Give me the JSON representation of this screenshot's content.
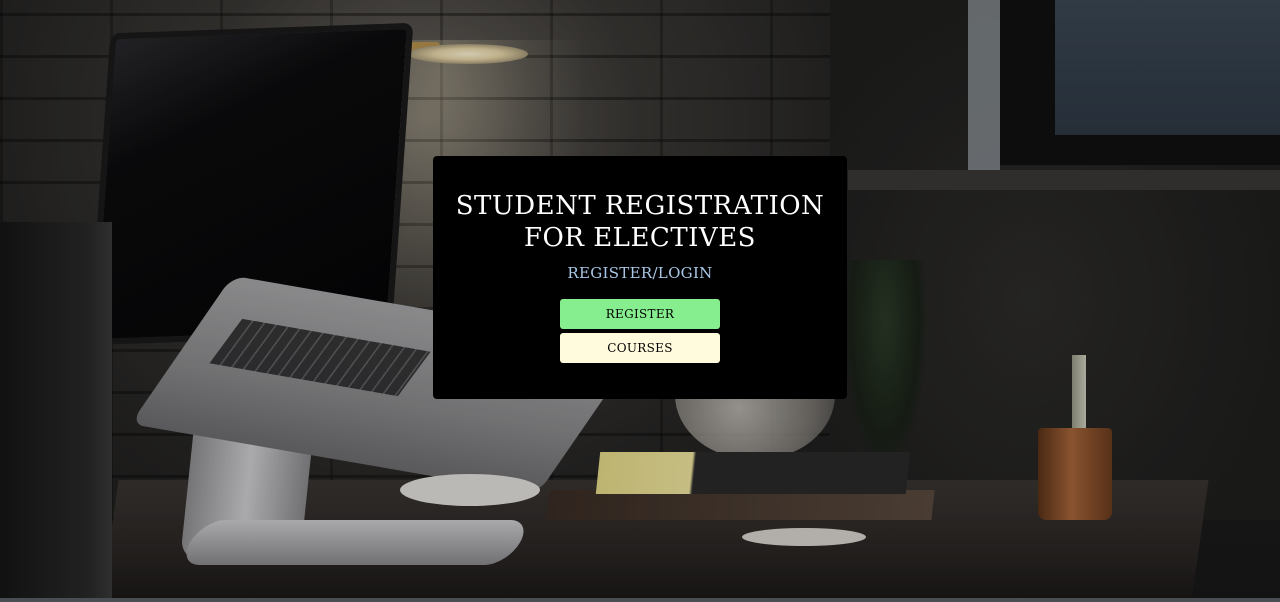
{
  "card": {
    "title_line1": "STUDENT REGISTRATION",
    "title_line2": "FOR ELECTIVES",
    "subtitle": "REGISTER/LOGIN",
    "register_label": "REGISTER",
    "courses_label": "COURSES"
  },
  "colors": {
    "card_background": "#000000",
    "title_text": "#ffffff",
    "subtitle_text": "#a9c7e6",
    "register_button": "#86ee8e",
    "courses_button": "#fffbdc"
  },
  "background": {
    "image_subject": "laptop-on-desk-with-lamp"
  }
}
